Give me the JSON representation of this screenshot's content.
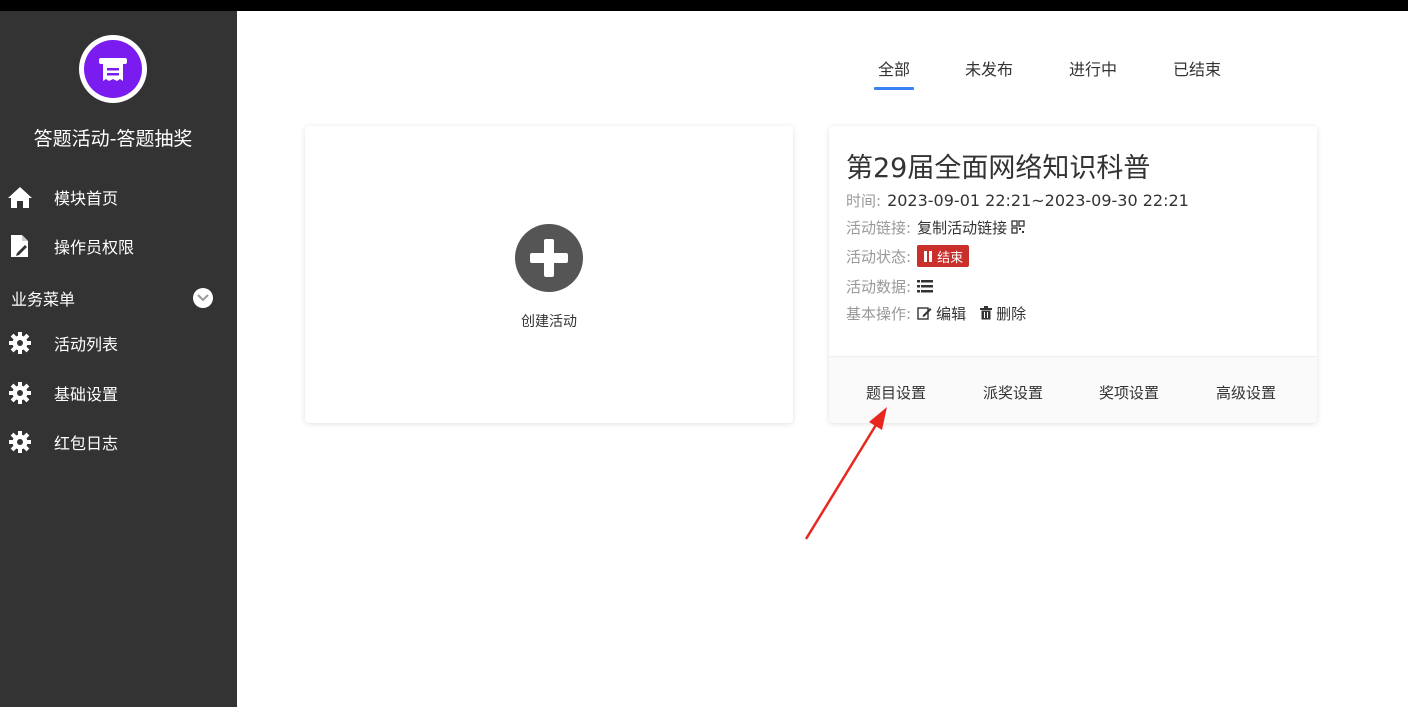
{
  "sidebar": {
    "app_title": "答题活动-答题抽奖",
    "items": [
      {
        "label": "模块首页",
        "icon": "home-icon"
      },
      {
        "label": "操作员权限",
        "icon": "document-edit-icon"
      }
    ],
    "section": {
      "label": "业务菜单",
      "toggle_icon": "chevron-down-icon"
    },
    "section_items": [
      {
        "label": "活动列表",
        "icon": "gear-icon"
      },
      {
        "label": "基础设置",
        "icon": "gear-icon"
      },
      {
        "label": "红包日志",
        "icon": "gear-icon"
      }
    ],
    "logo_color": "#7a1cf0"
  },
  "tabs": {
    "items": [
      "全部",
      "未发布",
      "进行中",
      "已结束"
    ],
    "active": "全部",
    "accent": "#3b82f6"
  },
  "create_card": {
    "label": "创建活动",
    "icon": "plus-circle-icon"
  },
  "activity": {
    "title": "第29届全面网络知识科普",
    "time_key": "时间:",
    "time_value": "2023-09-01 22:21~2023-09-30 22:21",
    "link_key": "活动链接:",
    "link_value": "复制活动链接",
    "status_key": "活动状态:",
    "status_value": "结束",
    "status_color": "#c9302c",
    "data_key": "活动数据:",
    "ops_key": "基本操作:",
    "edit_label": "编辑",
    "delete_label": "删除",
    "footer": [
      "题目设置",
      "派奖设置",
      "奖项设置",
      "高级设置"
    ]
  },
  "annotation": {
    "arrow_color": "#e8281e"
  }
}
